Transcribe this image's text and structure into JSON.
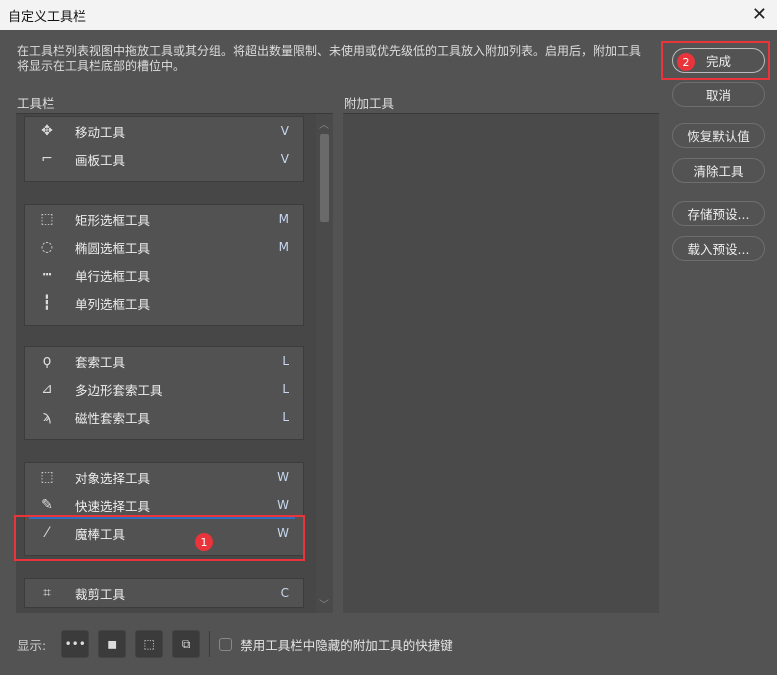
{
  "title": "自定义工具栏",
  "description": "在工具栏列表视图中拖放工具或其分组。将超出数量限制、未使用或优先级低的工具放入附加列表。启用后，附加工具将显示在工具栏底部的槽位中。",
  "toolbar_label": "工具栏",
  "extra_label": "附加工具",
  "groups": [
    {
      "items": [
        {
          "icon": "move-icon",
          "glyph": "✥",
          "name": "移动工具",
          "key": "V"
        },
        {
          "icon": "artboard-icon",
          "glyph": "⌐",
          "name": "画板工具",
          "key": "V"
        }
      ]
    },
    {
      "items": [
        {
          "icon": "rect-marquee-icon",
          "glyph": "⬚",
          "name": "矩形选框工具",
          "key": "M"
        },
        {
          "icon": "ellipse-marquee-icon",
          "glyph": "◌",
          "name": "椭圆选框工具",
          "key": "M"
        },
        {
          "icon": "single-row-marquee-icon",
          "glyph": "┅",
          "name": "单行选框工具",
          "key": ""
        },
        {
          "icon": "single-column-marquee-icon",
          "glyph": "┇",
          "name": "单列选框工具",
          "key": ""
        }
      ]
    },
    {
      "items": [
        {
          "icon": "lasso-icon",
          "glyph": "ϙ",
          "name": "套索工具",
          "key": "L"
        },
        {
          "icon": "polygon-lasso-icon",
          "glyph": "⊿",
          "name": "多边形套索工具",
          "key": "L"
        },
        {
          "icon": "magnetic-lasso-icon",
          "glyph": "ϡ",
          "name": "磁性套索工具",
          "key": "L"
        }
      ]
    },
    {
      "items": [
        {
          "icon": "object-select-icon",
          "glyph": "⬚",
          "name": "对象选择工具",
          "key": "W"
        },
        {
          "icon": "quick-select-icon",
          "glyph": "✎",
          "name": "快速选择工具",
          "key": "W"
        },
        {
          "icon": "magic-wand-icon",
          "glyph": "⁄",
          "name": "魔棒工具",
          "key": "W"
        }
      ]
    },
    {
      "items": [
        {
          "icon": "crop-icon",
          "glyph": "⌗",
          "name": "裁剪工具",
          "key": "C"
        }
      ]
    }
  ],
  "buttons": {
    "done": "完成",
    "cancel": "取消",
    "restore": "恢复默认值",
    "clear": "清除工具",
    "save": "存储预设...",
    "load": "载入预设..."
  },
  "badges": {
    "one": "1",
    "two": "2"
  },
  "bottom": {
    "show_label": "显示:",
    "checkbox_label": "禁用工具栏中隐藏的附加工具的快捷键",
    "checkbox_checked": false
  }
}
